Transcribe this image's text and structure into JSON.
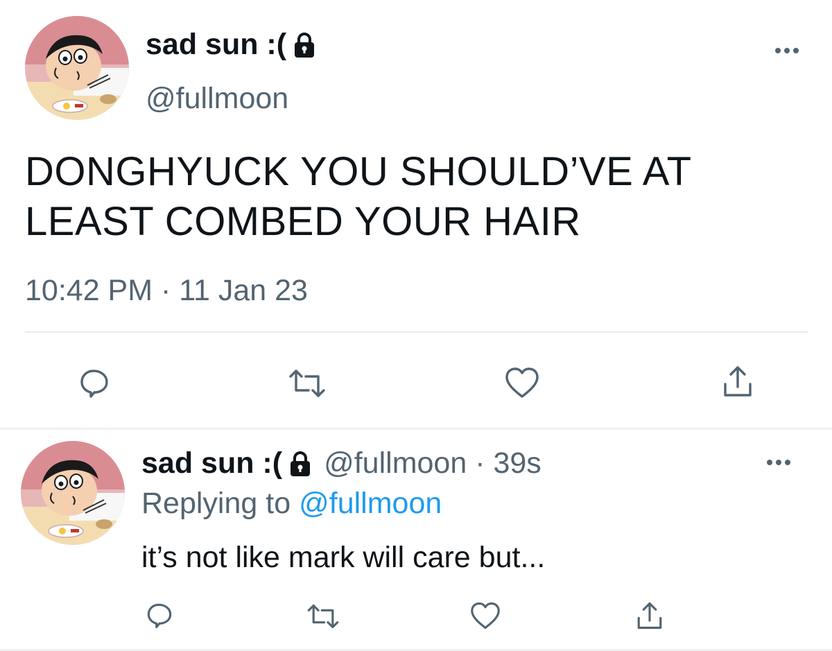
{
  "main_tweet": {
    "display_name": "sad sun :(",
    "handle": "@fullmoon",
    "text": "DONGHYUCK YOU SHOULD’VE AT LEAST COMBED YOUR HAIR",
    "timestamp": "10:42 PM · 11 Jan 23",
    "icons": [
      "lock-icon",
      "more-icon",
      "reply-icon",
      "retweet-icon",
      "like-icon",
      "share-icon"
    ]
  },
  "reply_tweet": {
    "display_name": "sad sun :(",
    "handle_time": "@fullmoon · 39s",
    "replying_prefix": "Replying to",
    "replying_mention": "@fullmoon",
    "text": "it’s not like mark will care but...",
    "icons": [
      "lock-icon",
      "more-icon",
      "reply-icon",
      "retweet-icon",
      "like-icon",
      "share-icon"
    ]
  },
  "colors": {
    "text_primary": "#0f1419",
    "text_secondary": "#536471",
    "mention": "#1d9bf0",
    "divider": "#e8ebed"
  }
}
